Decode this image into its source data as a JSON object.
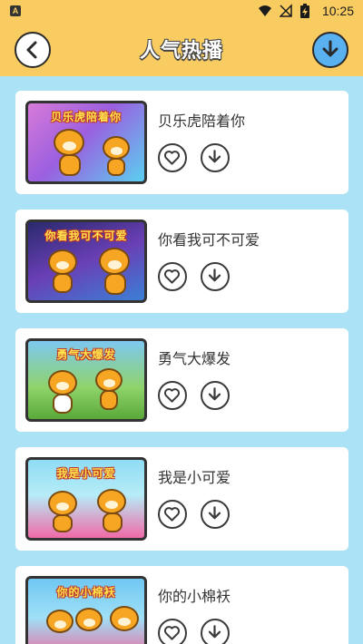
{
  "status_bar": {
    "time": "10:25",
    "app_badge": "A",
    "icons": [
      "wifi-icon",
      "signal-off-icon",
      "battery-charging-icon"
    ]
  },
  "header": {
    "title": "人气热播",
    "back_icon": "back-arrow-icon",
    "download_icon": "download-icon"
  },
  "colors": {
    "header_bg": "#f9cc62",
    "page_bg": "#abe2f5",
    "card_bg": "#ffffff",
    "download_btn": "#5ab1ef"
  },
  "songs": [
    {
      "title": "贝乐虎陪着你",
      "thumb_caption": "贝乐虎陪着你",
      "like_icon": "heart-icon",
      "download_icon": "download-icon"
    },
    {
      "title": "你看我可不可爱",
      "thumb_caption": "你看我可不可爱",
      "like_icon": "heart-icon",
      "download_icon": "download-icon"
    },
    {
      "title": "勇气大爆发",
      "thumb_caption": "勇气大爆发",
      "like_icon": "heart-icon",
      "download_icon": "download-icon"
    },
    {
      "title": "我是小可爱",
      "thumb_caption": "我是小可爱",
      "like_icon": "heart-icon",
      "download_icon": "download-icon"
    },
    {
      "title": "你的小棉袄",
      "thumb_caption": "你的小棉袄",
      "like_icon": "heart-icon",
      "download_icon": "download-icon"
    }
  ]
}
